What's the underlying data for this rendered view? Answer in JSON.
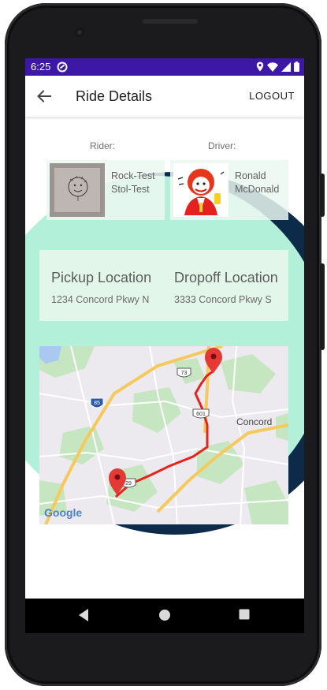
{
  "status_bar": {
    "time": "6:25",
    "background": "#3d17a6"
  },
  "app_bar": {
    "title": "Ride Details",
    "logout_label": "LOGOUT"
  },
  "rider": {
    "label": "Rider:",
    "name_line1": "Rock-Test",
    "name_line2": "Stol-Test"
  },
  "driver": {
    "label": "Driver:",
    "name_line1": "Ronald",
    "name_line2": "McDonald"
  },
  "pickup": {
    "heading": "Pickup Location",
    "address": "1234 Concord Pkwy N"
  },
  "dropoff": {
    "heading": "Dropoff Location",
    "address": "3333 Concord Pkwy S"
  },
  "map": {
    "city_label": "Concord",
    "attribution": "Google",
    "route_shields": [
      "85",
      "73",
      "601",
      "29"
    ],
    "route_color": "#e8221c"
  },
  "colors": {
    "accent_mint": "#b3f0d9",
    "navy": "#0c2a4a"
  },
  "icons": {
    "back": "back-arrow-icon",
    "nav_back": "nav-back-icon",
    "nav_home": "nav-home-icon",
    "nav_recents": "nav-recents-icon"
  }
}
